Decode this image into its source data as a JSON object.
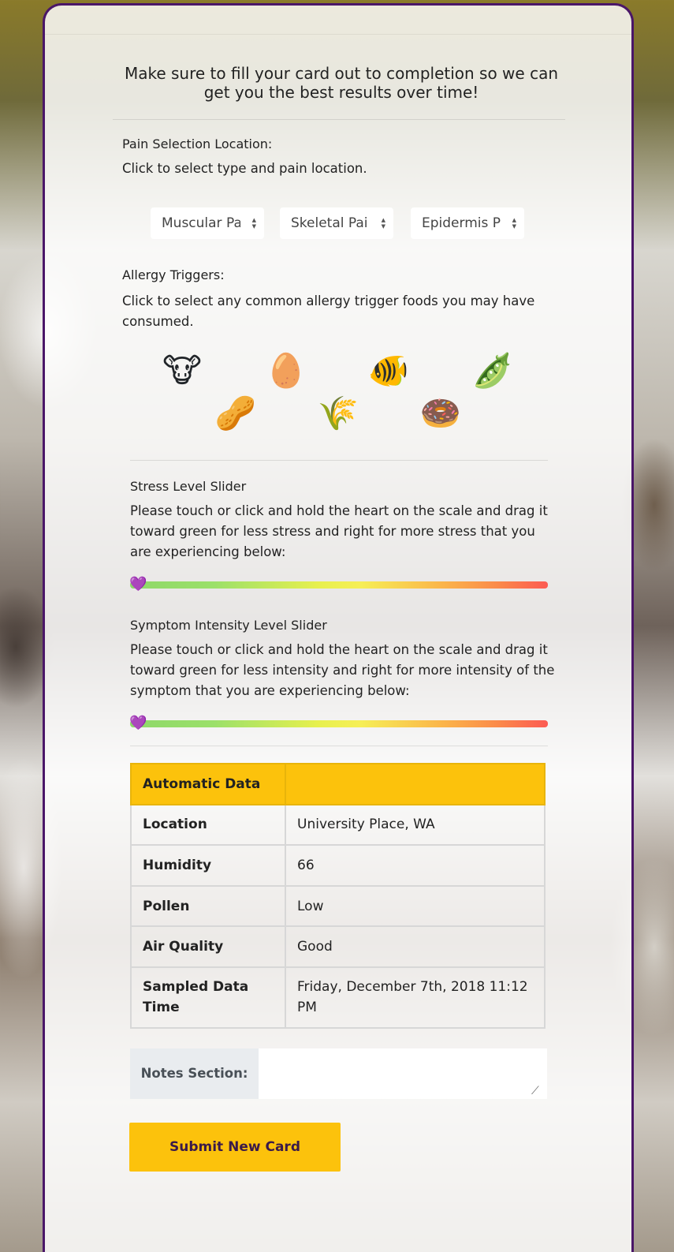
{
  "intro": {
    "text": "Make sure to fill your card out to completion so we can get you the best results over time!"
  },
  "pain": {
    "label": "Pain Selection Location:",
    "instructions": "Click to select type and pain location.",
    "selects": [
      {
        "value": "Muscular Pa"
      },
      {
        "value": "Skeletal Pai"
      },
      {
        "value": "Epidermis P"
      }
    ]
  },
  "allergy": {
    "label": "Allergy Triggers:",
    "instructions": "Click to select any common allergy trigger foods you may have consumed.",
    "foods": [
      {
        "icon": "🐮",
        "name": "cow-icon"
      },
      {
        "icon": "🥚",
        "name": "egg-icon"
      },
      {
        "icon": "🐠",
        "name": "fish-icon"
      },
      {
        "icon": "🫛",
        "name": "soybean-icon"
      },
      {
        "icon": "🥜",
        "name": "peanut-icon"
      },
      {
        "icon": "🌾",
        "name": "wheat-icon"
      },
      {
        "icon": "🍩",
        "name": "donut-icon"
      }
    ]
  },
  "stress": {
    "label": "Stress Level Slider",
    "instructions": "Please touch or click and hold the heart on the scale and drag it toward green for less stress and right for more stress that you are experiencing below:",
    "value": 0
  },
  "symptom": {
    "label": "Symptom Intensity Level Slider",
    "instructions": "Please touch or click and hold the heart on the scale and drag it toward green for less intensity and right for more intensity of the symptom that you are experiencing below:",
    "value": 0
  },
  "slider_thumb_icon": "💜",
  "auto_data": {
    "header": "Automatic Data",
    "rows": [
      {
        "key": "Location",
        "value": "University Place, WA"
      },
      {
        "key": "Humidity",
        "value": "66"
      },
      {
        "key": "Pollen",
        "value": "Low"
      },
      {
        "key": "Air Quality",
        "value": "Good"
      },
      {
        "key": "Sampled Data Time",
        "value": "Friday, December 7th, 2018 11:12 PM"
      }
    ]
  },
  "notes": {
    "label": "Notes Section:",
    "value": ""
  },
  "submit": {
    "label": "Submit New Card"
  },
  "colors": {
    "accent": "#fcc20c",
    "border": "#4a1668"
  }
}
